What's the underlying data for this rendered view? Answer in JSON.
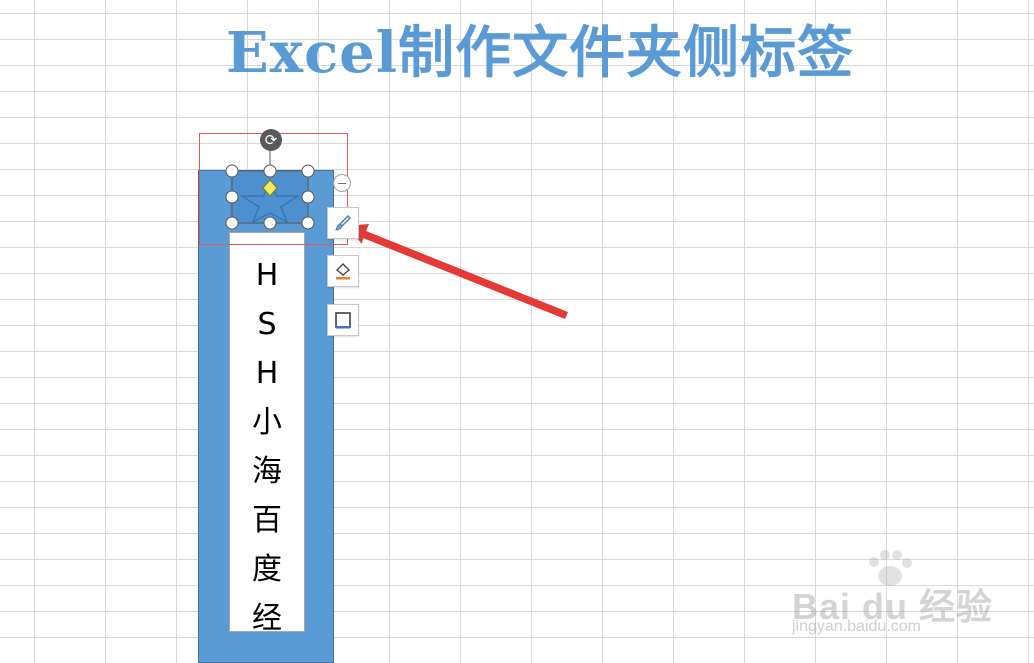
{
  "title": "Excel制作文件夹侧标签",
  "label": {
    "chars": [
      "H",
      "S",
      "H",
      "小",
      "海",
      "百",
      "度",
      "经"
    ]
  },
  "toolbar": {
    "buttons": [
      {
        "name": "shape-style-button",
        "icon": "brush-icon"
      },
      {
        "name": "fill-color-button",
        "icon": "paint-bucket-icon"
      },
      {
        "name": "outline-button",
        "icon": "outline-square-icon"
      }
    ],
    "collapse_icon": "minus-circle-icon"
  },
  "rotate_icon": "rotate-icon",
  "watermark": {
    "main": "Bai du 经验",
    "sub": "jingyan.baidu.com"
  },
  "colors": {
    "accent": "#5b9bd5",
    "arrow": "#e53935",
    "selection": "#e05a5a"
  }
}
